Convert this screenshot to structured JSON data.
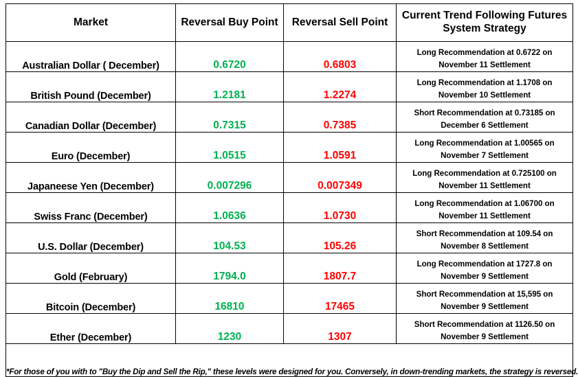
{
  "table": {
    "headers": {
      "market": "Market",
      "buy": "Reversal Buy Point",
      "sell": "Reversal Sell Point",
      "strategy_line1": "Current Trend Following Futures",
      "strategy_line2": "System Strategy"
    },
    "rows": [
      {
        "market": "Australian Dollar ( December)",
        "buy": "0.6720",
        "sell": "0.6803",
        "strategy_line1": "Long Recommendation at 0.6722 on",
        "strategy_line2": "November 11 Settlement"
      },
      {
        "market": "British Pound (December)",
        "buy": "1.2181",
        "sell": "1.2274",
        "strategy_line1": "Long Recommendation at 1.1708 on",
        "strategy_line2": "November 10 Settlement"
      },
      {
        "market": "Canadian Dollar (December)",
        "buy": "0.7315",
        "sell": "0.7385",
        "strategy_line1": "Short Recommendation at 0.73185 on",
        "strategy_line2": "December 6 Settlement"
      },
      {
        "market": "Euro (December)",
        "buy": "1.0515",
        "sell": "1.0591",
        "strategy_line1": "Long Recommendation at 1.00565 on",
        "strategy_line2": "November 7 Settlement"
      },
      {
        "market": "Japaneese Yen (December)",
        "buy": "0.007296",
        "sell": "0.007349",
        "strategy_line1": "Long Recommendation at 0.725100 on",
        "strategy_line2": "November 11 Settlement"
      },
      {
        "market": "Swiss Franc (December)",
        "buy": "1.0636",
        "sell": "1.0730",
        "strategy_line1": "Long Recommendation at 1.06700 on",
        "strategy_line2": "November 11 Settlement"
      },
      {
        "market": "U.S. Dollar (December)",
        "buy": "104.53",
        "sell": "105.26",
        "strategy_line1": "Short Recommendation at 109.54 on",
        "strategy_line2": "November 8 Settlement"
      },
      {
        "market": "Gold (February)",
        "buy": "1794.0",
        "sell": "1807.7",
        "strategy_line1": "Long Recommendation at 1727.8 on",
        "strategy_line2": "November 9 Settlement"
      },
      {
        "market": "Bitcoin (December)",
        "buy": "16810",
        "sell": "17465",
        "strategy_line1": "Short Recommendation at 15,595 on",
        "strategy_line2": "November 9 Settlement"
      },
      {
        "market": "Ether (December)",
        "buy": "1230",
        "sell": "1307",
        "strategy_line1": "Short Recommendation at 1126.50 on",
        "strategy_line2": "November 9 Settlement"
      }
    ],
    "footnote": "*For those of you with to \"Buy the Dip and Sell the Rip,\" these levels were designed for you. Conversely, in down-trending markets, the strategy is reversed."
  },
  "colors": {
    "buy_green": "#00b050",
    "sell_red": "#ff0000",
    "border": "#000000",
    "text": "#000000",
    "background": "#ffffff"
  }
}
